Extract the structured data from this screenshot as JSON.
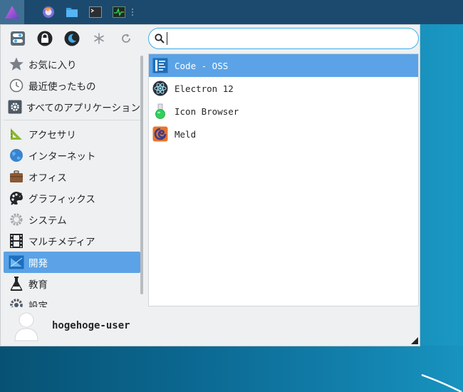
{
  "panel": {
    "launchers": [
      {
        "icon": "firefox-icon"
      },
      {
        "icon": "folder-icon"
      },
      {
        "icon": "terminal-icon"
      },
      {
        "icon": "system-monitor-icon"
      }
    ]
  },
  "quick_actions": [
    {
      "icon": "settings-toggle-icon"
    },
    {
      "icon": "lock-icon"
    },
    {
      "icon": "suspend-icon"
    },
    {
      "icon": "hibernate-icon"
    },
    {
      "icon": "restart-icon"
    }
  ],
  "search": {
    "value": "",
    "placeholder": ""
  },
  "categories": {
    "favorites": "お気に入り",
    "recent": "最近使ったもの",
    "all": "すべてのアプリケーション",
    "items": [
      {
        "label": "アクセサリ",
        "icon": "accessories-icon"
      },
      {
        "label": "インターネット",
        "icon": "internet-icon"
      },
      {
        "label": "オフィス",
        "icon": "office-icon"
      },
      {
        "label": "グラフィックス",
        "icon": "graphics-icon"
      },
      {
        "label": "システム",
        "icon": "system-icon"
      },
      {
        "label": "マルチメディア",
        "icon": "multimedia-icon"
      },
      {
        "label": "開発",
        "icon": "development-icon",
        "selected": true
      },
      {
        "label": "教育",
        "icon": "education-icon"
      },
      {
        "label": "設定",
        "icon": "settings-icon"
      }
    ]
  },
  "apps": [
    {
      "label": "Code - OSS",
      "icon": "code-oss-icon",
      "selected": true
    },
    {
      "label": "Electron 12",
      "icon": "electron-icon"
    },
    {
      "label": "Icon Browser",
      "icon": "icon-browser-icon"
    },
    {
      "label": "Meld",
      "icon": "meld-icon"
    }
  ],
  "user": {
    "name": "hogehoge-user"
  },
  "colors": {
    "accent": "#5ba3e6",
    "search_border": "#3daee9",
    "panel": "#1c4a6e"
  }
}
